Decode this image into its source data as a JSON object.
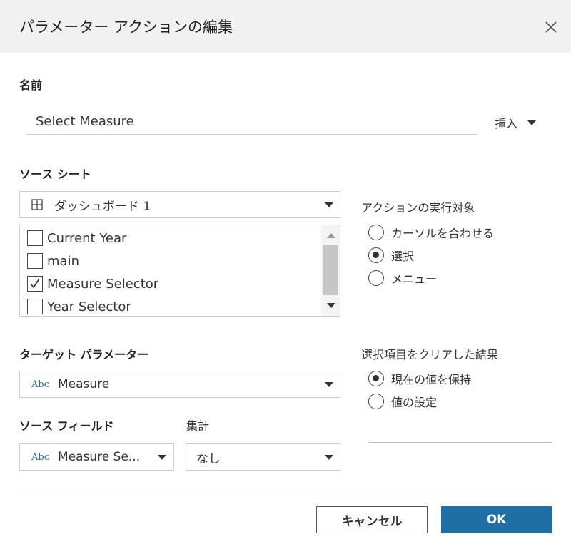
{
  "dialog": {
    "title": "パラメーター アクションの編集",
    "close_icon": "close-icon"
  },
  "name_section": {
    "label": "名前",
    "value": "Select Measure",
    "insert_label": "挿入"
  },
  "source_sheets": {
    "label": "ソース シート",
    "dashboard": "ダッシュボード 1",
    "dashboard_icon": "grid-icon",
    "items": [
      {
        "label": "Current Year",
        "checked": false
      },
      {
        "label": "main",
        "checked": false
      },
      {
        "label": "Measure Selector",
        "checked": true
      },
      {
        "label": "Year Selector",
        "checked": false
      }
    ]
  },
  "run_action_on": {
    "label": "アクションの実行対象",
    "options": [
      {
        "label": "カーソルを合わせる",
        "selected": false
      },
      {
        "label": "選択",
        "selected": true
      },
      {
        "label": "メニュー",
        "selected": false
      }
    ]
  },
  "target_parameter": {
    "label": "ターゲット パラメーター",
    "type_badge": "Abc",
    "value": "Measure"
  },
  "clear_selection": {
    "label": "選択項目をクリアした結果",
    "options": [
      {
        "label": "現在の値を保持",
        "selected": true
      },
      {
        "label": "値の設定",
        "selected": false
      }
    ]
  },
  "source_field": {
    "label": "ソース フィールド",
    "type_badge": "Abc",
    "value": "Measure Se..."
  },
  "aggregation": {
    "label": "集計",
    "value": "なし"
  },
  "buttons": {
    "cancel": "キャンセル",
    "ok": "OK"
  },
  "colors": {
    "primary": "#1f6ea5",
    "abc_badge": "#2e6ea3",
    "title_bar": "#f1f1f1"
  }
}
